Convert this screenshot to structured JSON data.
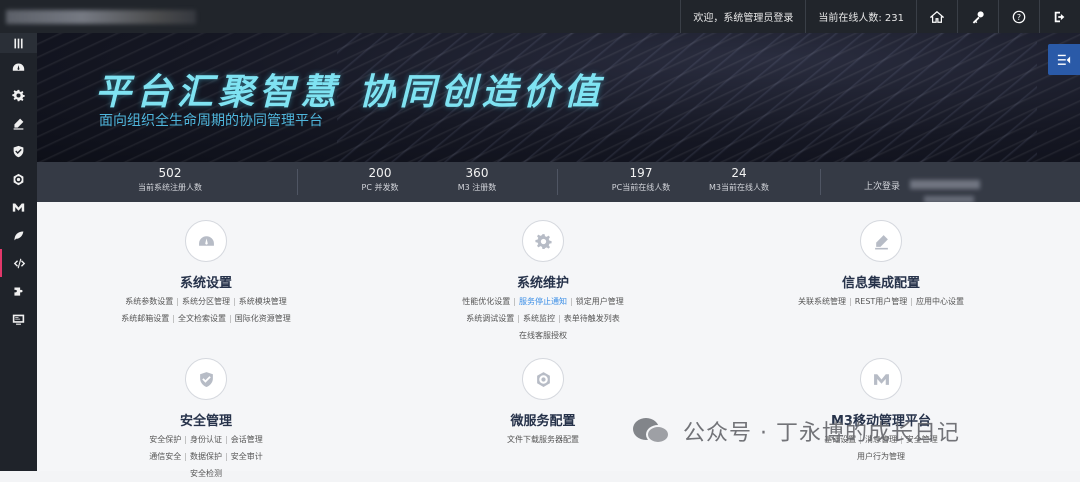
{
  "topbar": {
    "welcome": "欢迎，系统管理员登录",
    "online_users": "当前在线人数: 231"
  },
  "sidebar": {
    "items": [
      {
        "icon": "menu-icon"
      },
      {
        "icon": "dashboard-icon"
      },
      {
        "icon": "gear-icon"
      },
      {
        "icon": "edit-icon"
      },
      {
        "icon": "shield-icon"
      },
      {
        "icon": "hexagon-icon"
      },
      {
        "icon": "m-logo-icon"
      },
      {
        "icon": "leaf-icon"
      },
      {
        "icon": "code-icon"
      },
      {
        "icon": "plugin-icon"
      },
      {
        "icon": "monitor-icon"
      }
    ]
  },
  "banner": {
    "slogan": "平台汇聚智慧 协同创造价值",
    "subtitle": "面向组织全生命周期的协同管理平台"
  },
  "stats": [
    {
      "num": "502",
      "label": "当前系统注册人数"
    },
    {
      "num": "200",
      "label": "PC 并发数"
    },
    {
      "num": "360",
      "label": "M3 注册数"
    },
    {
      "num": "197",
      "label": "PC当前在线人数"
    },
    {
      "num": "24",
      "label": "M3当前在线人数"
    }
  ],
  "last_login_label": "上次登录",
  "modules": [
    {
      "title": "系统设置",
      "icon": "dashboard-icon",
      "lines": [
        [
          "系统参数设置",
          "系统分区管理",
          "系统模块管理"
        ],
        [
          "系统邮箱设置",
          "全文检索设置",
          "国际化资源管理"
        ]
      ]
    },
    {
      "title": "系统维护",
      "icon": "gear-icon",
      "lines": [
        [
          "性能优化设置",
          "服务停止通知",
          "锁定用户管理"
        ],
        [
          "系统调试设置",
          "系统监控",
          "表单待触发列表"
        ],
        [
          "在线客服授权"
        ]
      ]
    },
    {
      "title": "信息集成配置",
      "icon": "edit-icon",
      "lines": [
        [
          "关联系统管理",
          "REST用户管理",
          "应用中心设置"
        ]
      ]
    },
    {
      "title": "安全管理",
      "icon": "shield-icon",
      "lines": [
        [
          "安全保护",
          "身份认证",
          "会话管理"
        ],
        [
          "通信安全",
          "数据保护",
          "安全审计"
        ],
        [
          "安全检测"
        ]
      ]
    },
    {
      "title": "微服务配置",
      "icon": "hexagon-icon",
      "lines": [
        [
          "文件下载服务器配置"
        ]
      ]
    },
    {
      "title": "M3移动管理平台",
      "icon": "m-logo-icon",
      "lines": [
        [
          "基础设置",
          "消息管理",
          "安全管理"
        ],
        [
          "用户行为管理"
        ]
      ]
    }
  ],
  "watermark": "公众号 · 丁永博的成长日记",
  "colors": {
    "accent": "#3a8ee6",
    "slogan": "#7fe3f2",
    "topbar": "#21252b",
    "statsbar": "#353a45"
  }
}
